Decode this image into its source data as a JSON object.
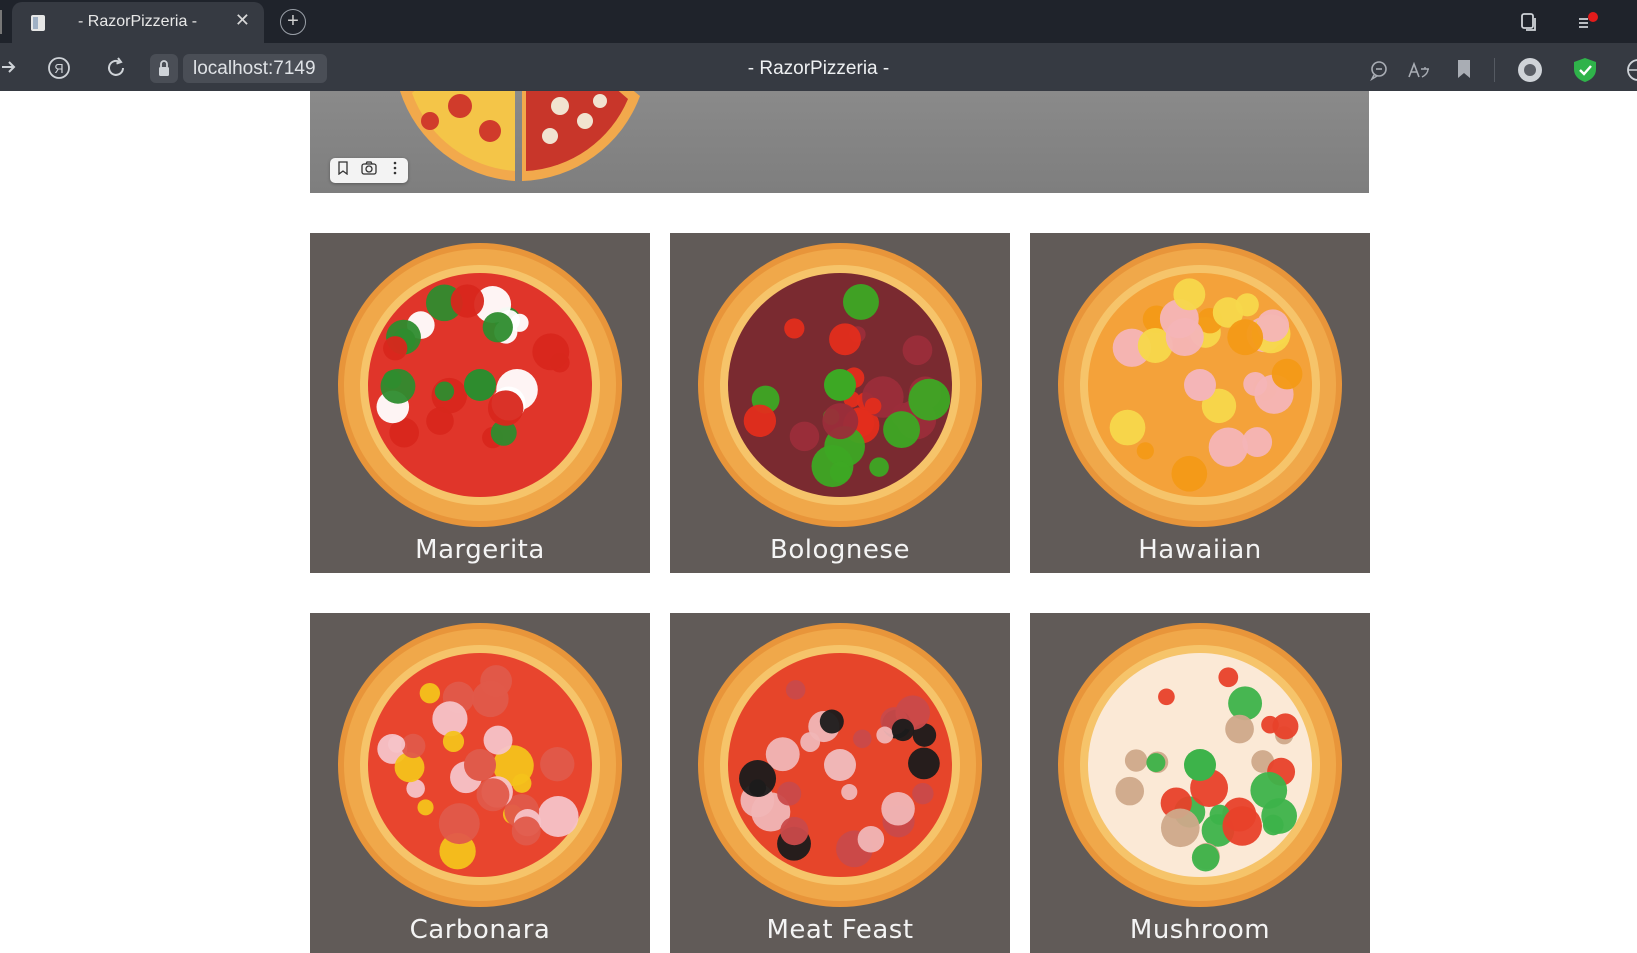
{
  "browser": {
    "tab_title": "- RazorPizzeria -",
    "tab_close": "✕",
    "new_tab": "+",
    "url": "localhost:7149",
    "page_title": "- RazorPizzeria -",
    "yandex_glyph": "Я",
    "accent_color": "#2fb34a"
  },
  "image_toolbar": {
    "icons": [
      "bookmark-icon",
      "camera-icon",
      "more-icon"
    ]
  },
  "pizzas": [
    {
      "name": "Margerita",
      "crust": "#f0a84a",
      "sauce": "#e0352a",
      "tops": [
        "#d8271c",
        "#2e8c2e",
        "#ffffff"
      ]
    },
    {
      "name": "Bolognese",
      "crust": "#f0a84a",
      "sauce": "#7a2a30",
      "tops": [
        "#e32d1c",
        "#3da824",
        "#9b2d3a"
      ]
    },
    {
      "name": "Hawaiian",
      "crust": "#f0a84a",
      "sauce": "#f4a23a",
      "tops": [
        "#f7d84b",
        "#f4b5b7",
        "#f39a16"
      ]
    },
    {
      "name": "Carbonara",
      "crust": "#f0a84a",
      "sauce": "#e8452e",
      "tops": [
        "#f6c3c8",
        "#e05a4a",
        "#f4c21b"
      ]
    },
    {
      "name": "Meat Feast",
      "crust": "#f0a84a",
      "sauce": "#e6452a",
      "tops": [
        "#c94a4a",
        "#f0b6b6",
        "#1b1b1b"
      ]
    },
    {
      "name": "Mushroom",
      "crust": "#f0a84a",
      "sauce": "#fbe9d6",
      "tops": [
        "#e8412a",
        "#3db34a",
        "#cfa98a"
      ]
    }
  ]
}
